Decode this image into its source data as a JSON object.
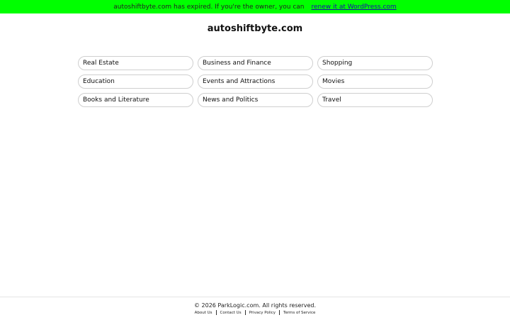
{
  "banner": {
    "message": "autoshiftbyte.com has expired. If you're the owner, you can",
    "link_text": "renew it at WordPress.com",
    "color": "#00ff00"
  },
  "site": {
    "domain": "autoshiftbyte.com"
  },
  "categories": [
    "Real Estate",
    "Business and Finance",
    "Shopping",
    "Education",
    "Events and Attractions",
    "Movies",
    "Books and Literature",
    "News and Politics",
    "Travel"
  ],
  "footer": {
    "copyright": "© 2026 ParkLogic.com. All rights reserved.",
    "links": [
      "About Us",
      "Contact Us",
      "Privacy Policy",
      "Terms of Service"
    ]
  }
}
